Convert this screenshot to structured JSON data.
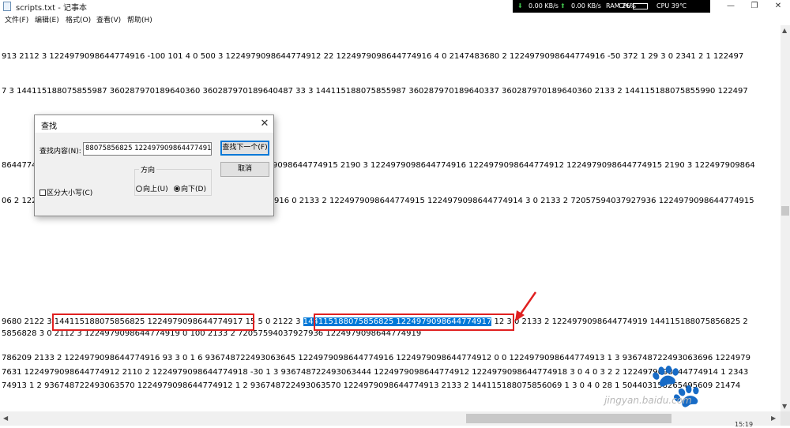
{
  "window": {
    "title": "scripts.txt - 记事本",
    "controls": {
      "minimize": "—",
      "maximize": "❐",
      "close": "✕"
    }
  },
  "netmeter": {
    "down": "0.00 KB/s",
    "up": "0.00 KB/s",
    "ram": "RAM 26%",
    "cpu_label": "CPU",
    "cpu_temp": "CPU 39℃",
    "down_icon": "⬇",
    "up_icon": "⬆"
  },
  "menu": [
    "文件(F)",
    "编辑(E)",
    "格式(O)",
    "查看(V)",
    "帮助(H)"
  ],
  "editor_lines": {
    "l1": "913 2112 3 1224979098644774916 -100 101 4 0 500 3 1224979098644774912 22 1224979098644774916 4 0 2147483680 2 1224979098644774916 -50 372 1 29 3 0 2341 2 1 122497",
    "l2": "7 3 144115188075855987 360287970189640360 360287970189640487 33 3 144115188075855987 360287970189640337 360287970189640360 2133 2 144115188075855990 122497",
    "l3a": "8644774",
    "l3b": "9098644774915 2190 3 1224979098644774916 1224979098644774912 1224979098644774915 2190 3 122497909864",
    "l4a": "06 2 122",
    "l4b": "916 0 2133 2 1224979098644774915 1224979098644774914 3 0 2133 2 72057594037927936 1224979098644774915",
    "l5_pre": "9680 2122 3 ",
    "l5_box": "144115188075856825 1224979098644774917",
    "l5_mid": " 15 5 0 2122 3 ",
    "l5_hl": "144115188075856825 1224979098644774917",
    "l5_post": " 12 3 0 2133 2 1224979098644774919 144115188075856825 2",
    "l6": "5856828 3 0 2112 3 1224979098644774919 0 100 2133 2 72057594037927936 1224979098644774919",
    "l7": "786209 2133 2 1224979098644774916 93 3 0 1 6 936748722493063645 1224979098644774916 1224979098644774912 0 0 1224979098644774913 1 3 936748722493063696 1224979",
    "l8": "7631 1224979098644774912 2110 2 1224979098644774918 -30 1 3 936748722493063444 1224979098644774912 1224979098644774918 3 0 4 0 3 2 2 1224979098644774914 1 2343",
    "l9": "74913 1 2 936748722493063570 1224979098644774912 1 2 936748722493063570 1224979098644774913 2133 2 144115188075856069 1 3 0 4 0 28 1 504403158265495609 21474"
  },
  "find_dialog": {
    "title": "查找",
    "find_label": "查找内容(N):",
    "find_value": "88075856825 1224979098644774917",
    "find_next": "查找下一个(F)",
    "cancel": "取消",
    "direction_label": "方向",
    "up": "向上(U)",
    "down": "向下(D)",
    "match_case": "区分大小写(C)",
    "direction_selected": "down",
    "match_case_checked": false
  },
  "watermark": {
    "text": "jingyan.baidu.com",
    "logo": "🐾"
  },
  "clock": "15:19",
  "colors": {
    "selection": "#0078d7",
    "annotation": "#e02020"
  }
}
